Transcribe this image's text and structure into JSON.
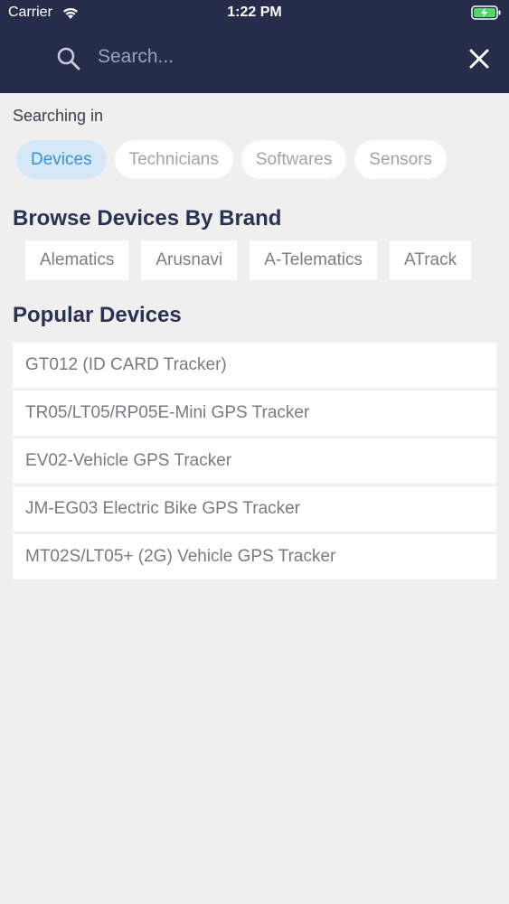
{
  "status_bar": {
    "carrier": "Carrier",
    "time": "1:22 PM"
  },
  "header": {
    "search_placeholder": "Search...",
    "background_color": "#252d4b"
  },
  "filter": {
    "label": "Searching in",
    "chips": [
      "Devices",
      "Technicians",
      "Softwares",
      "Sensors"
    ],
    "active": "Devices"
  },
  "brands": {
    "title": "Browse Devices By Brand",
    "items": [
      "Alematics",
      "Arusnavi",
      "A-Telematics",
      "ATrack"
    ]
  },
  "popular": {
    "title": "Popular Devices",
    "items": [
      "GT012 (ID CARD Tracker)",
      "TR05/LT05/RP05E-Mini GPS Tracker",
      "EV02-Vehicle GPS Tracker",
      "JM-EG03 Electric Bike GPS Tracker",
      "MT02S/LT05+ (2G) Vehicle GPS Tracker"
    ]
  },
  "colors": {
    "accent": "#3a8fd6",
    "active_chip_bg": "#d4e8f8",
    "title": "#2a3252",
    "page_bg": "#efeff0"
  }
}
